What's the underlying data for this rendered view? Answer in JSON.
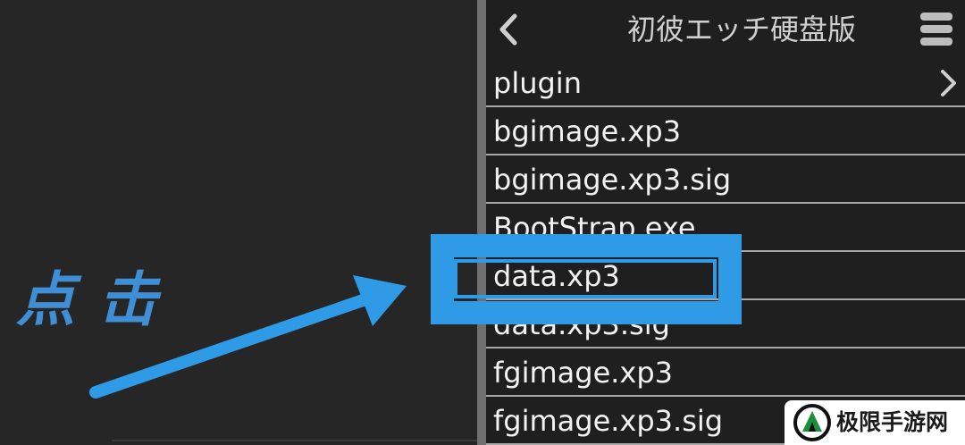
{
  "header": {
    "title": "初彼エッチ硬盘版"
  },
  "files": [
    {
      "name": "plugin",
      "folder": true
    },
    {
      "name": "bgimage.xp3",
      "folder": false
    },
    {
      "name": "bgimage.xp3.sig",
      "folder": false
    },
    {
      "name": "BootStrap.exe",
      "folder": false
    },
    {
      "name": "data.xp3",
      "folder": false
    },
    {
      "name": "data.xp3.sig",
      "folder": false
    },
    {
      "name": "fgimage.xp3",
      "folder": false
    },
    {
      "name": "fgimage.xp3.sig",
      "folder": false
    }
  ],
  "annotation": {
    "label": "点击",
    "highlighted_item": "data.xp3",
    "color": "#2f9be6"
  },
  "watermark": {
    "text": "极限手游网"
  },
  "icons": {
    "back": "chevron-left-icon",
    "menu": "menu-icon",
    "folder_arrow": "chevron-right-icon"
  }
}
